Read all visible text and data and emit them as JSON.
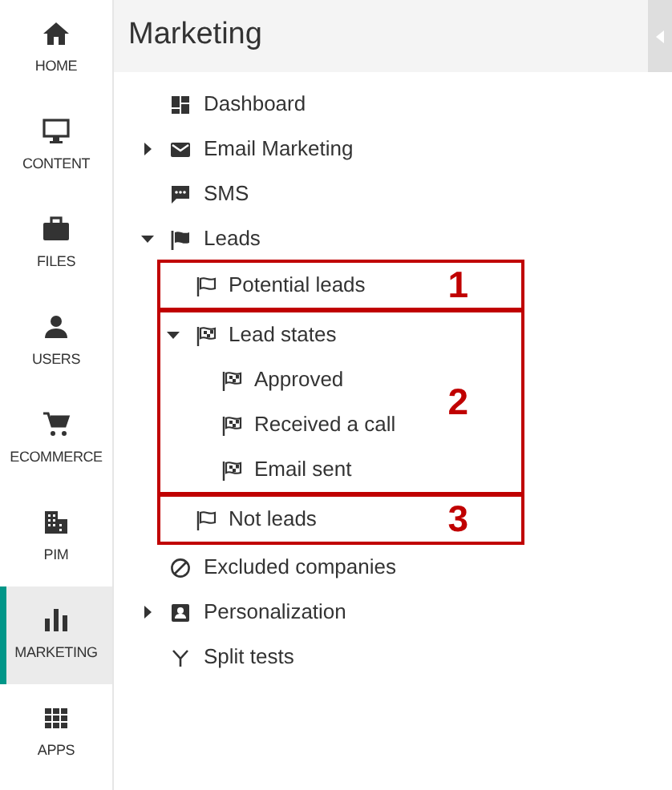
{
  "rail": [
    {
      "label": "HOME",
      "selected": false
    },
    {
      "label": "CONTENT",
      "selected": false
    },
    {
      "label": "FILES",
      "selected": false
    },
    {
      "label": "USERS",
      "selected": false
    },
    {
      "label": "ECOMMERCE",
      "selected": false
    },
    {
      "label": "PIM",
      "selected": false
    },
    {
      "label": "MARKETING",
      "selected": true
    },
    {
      "label": "APPS",
      "selected": false
    }
  ],
  "header": {
    "title": "Marketing"
  },
  "tree": [
    {
      "label": "Dashboard"
    },
    {
      "label": "Email Marketing",
      "expanded": false
    },
    {
      "label": "SMS"
    },
    {
      "label": "Leads",
      "expanded": true,
      "children": [
        {
          "label": "Potential leads",
          "callout": "1"
        },
        {
          "label": "Lead states",
          "expanded": true,
          "callout": "2",
          "children": [
            {
              "label": "Approved"
            },
            {
              "label": "Received a call"
            },
            {
              "label": "Email sent"
            }
          ]
        },
        {
          "label": "Not leads",
          "callout": "3"
        }
      ]
    },
    {
      "label": "Excluded companies"
    },
    {
      "label": "Personalization",
      "expanded": false
    },
    {
      "label": "Split tests"
    }
  ]
}
